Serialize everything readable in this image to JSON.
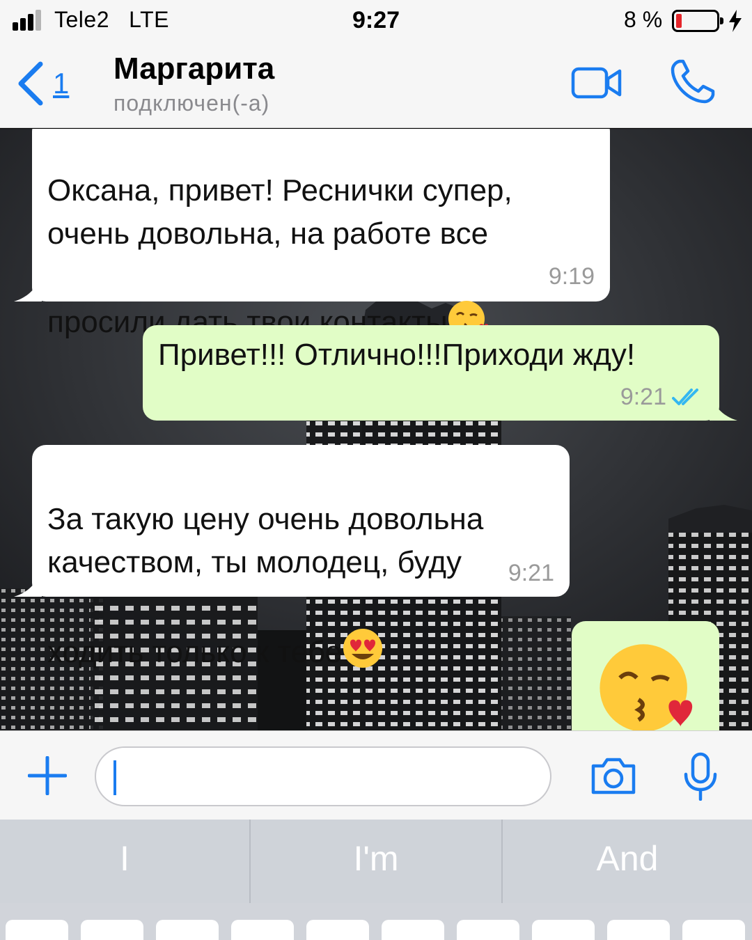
{
  "status_bar": {
    "carrier": "Tele2",
    "network": "LTE",
    "time": "9:27",
    "battery_percent": "8 %"
  },
  "header": {
    "back_count": "1",
    "contact_name": "Маргарита",
    "contact_status": "подключен(-а)",
    "icons": [
      "chevron-left-icon",
      "video-call-icon",
      "phone-icon"
    ]
  },
  "messages": [
    {
      "direction": "incoming",
      "text": "Оксана, привет! Реснички супер,\nочень довольна, на работе все\nпросили дать твои контакты",
      "emoji": "face-blowing-kiss",
      "time": "9:19"
    },
    {
      "direction": "outgoing",
      "text": "Привет!!! Отлично!!!Приходи жду!",
      "time": "9:21",
      "status": "read"
    },
    {
      "direction": "incoming",
      "text": "За такую цену очень довольна\nкачеством, ты молодец, буду\nходить только к тебе",
      "emoji": "smiling-face-with-heart-eyes",
      "time": "9:21"
    },
    {
      "direction": "outgoing",
      "emoji": "face-blowing-kiss"
    }
  ],
  "input": {
    "placeholder": "",
    "icons": [
      "plus-icon",
      "camera-icon",
      "microphone-icon"
    ]
  },
  "keyboard": {
    "suggestions": [
      "I",
      "I'm",
      "And"
    ]
  },
  "colors": {
    "accent": "#1a7cf0",
    "incoming_bubble": "#ffffff",
    "outgoing_bubble": "#e1fdc6",
    "read_ticks": "#34b7f1",
    "battery_low": "#e5262b"
  }
}
